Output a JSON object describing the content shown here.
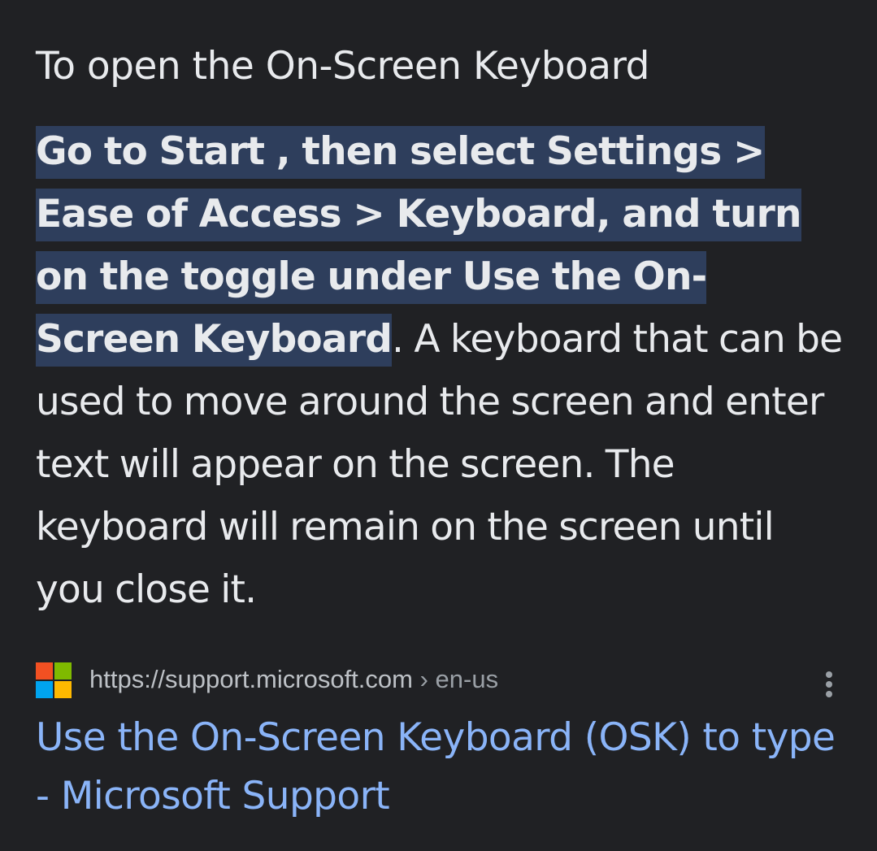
{
  "snippet": {
    "heading": "To open the On-Screen Keyboard",
    "highlight": "Go to Start , then select Settings > Ease of Access > Keyboard, and turn on the toggle under Use the On-Screen Keyboard",
    "rest": ". A keyboard that can be used to move around the screen and enter text will appear on the screen. The keyboard will remain on the screen until you close it."
  },
  "source": {
    "icon": "microsoft-logo-icon",
    "url": "https://support.microsoft.com",
    "separator": " › ",
    "path": "en-us",
    "menu_icon": "more-vert-icon"
  },
  "result": {
    "title": "Use the On-Screen Keyboard (OSK) to type - Microsoft Support"
  },
  "colors": {
    "background": "#202124",
    "text": "#e8eaed",
    "highlight_bg": "#2e3e5c",
    "link": "#8ab4f8",
    "url_text": "#bdc1c6"
  }
}
